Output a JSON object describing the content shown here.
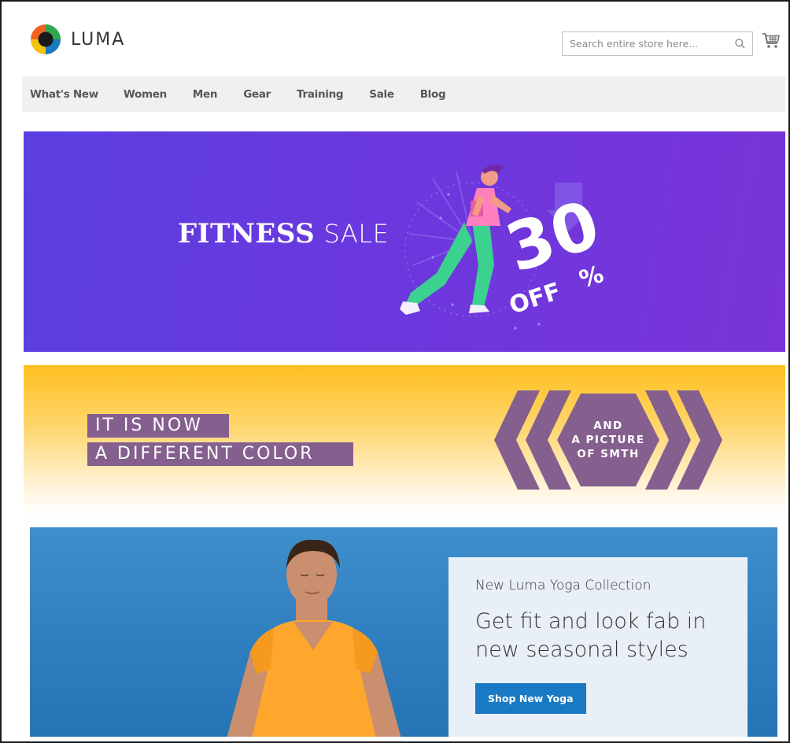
{
  "header": {
    "brand": "LUMA",
    "search_placeholder": "Search entire store here...",
    "icons": {
      "logo": "luma-logo-icon",
      "search": "search-icon",
      "cart": "cart-icon"
    }
  },
  "nav": {
    "items": [
      {
        "label": "What's New"
      },
      {
        "label": "Women"
      },
      {
        "label": "Men"
      },
      {
        "label": "Gear"
      },
      {
        "label": "Training"
      },
      {
        "label": "Sale"
      },
      {
        "label": "Blog"
      }
    ]
  },
  "banner_fitness": {
    "title_bold": "FITNESS",
    "title_light": "SALE",
    "discount": "30",
    "percent": "%",
    "off": "OFF"
  },
  "banner_color": {
    "line1": "IT IS NOW",
    "line2": "A DIFFERENT COLOR",
    "badge_line1": "AND",
    "badge_line2": "A PICTURE",
    "badge_line3": "OF SMTH"
  },
  "banner_yoga": {
    "kicker": "New Luma Yoga Collection",
    "headline": "Get fit and look fab in new seasonal styles",
    "button": "Shop New Yoga"
  },
  "colors": {
    "accent": "#1979c3",
    "fitness_bg": "#6a38de",
    "banner_purple": "#85608f",
    "banner_yellow": "#ffbf1f",
    "yoga_bg": "#2f7fc0"
  }
}
